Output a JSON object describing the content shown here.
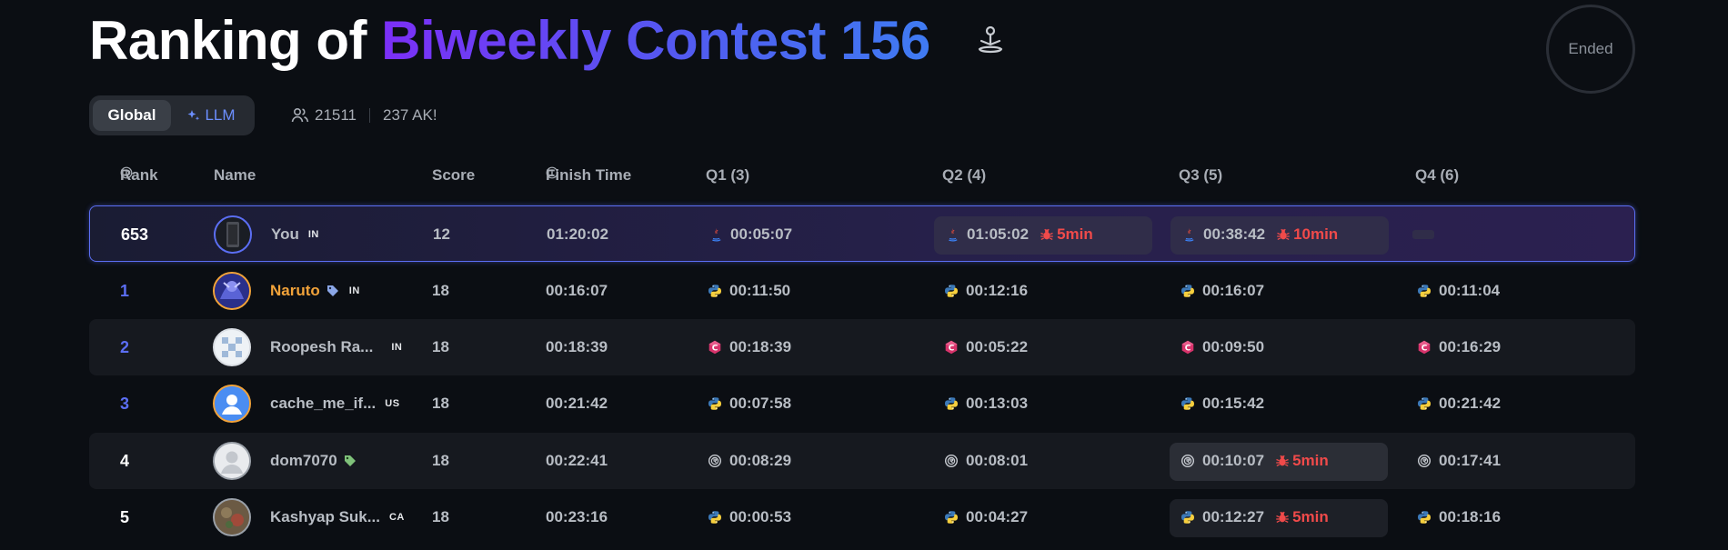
{
  "header": {
    "title_prefix": "Ranking of ",
    "title_highlight": "Biweekly Contest 156",
    "status": "Ended"
  },
  "toggle": {
    "global_label": "Global",
    "llm_label": "LLM"
  },
  "stats": {
    "participants": "21511",
    "ak": "237 AK!"
  },
  "columns": {
    "rank": "Rank",
    "name": "Name",
    "score": "Score",
    "finish": "Finish Time",
    "q1": "Q1 (3)",
    "q2": "Q2 (4)",
    "q3": "Q3 (5)",
    "q4": "Q4 (6)"
  },
  "rows": [
    {
      "rank": "653",
      "name": "You",
      "flag": "IN",
      "score": "12",
      "finish": "01:20:02",
      "q1": "00:05:07",
      "q2": "01:05:02",
      "q2_penalty": "5min",
      "q3": "00:38:42",
      "q3_penalty": "10min"
    },
    {
      "rank": "1",
      "name": "Naruto",
      "flag": "IN",
      "score": "18",
      "finish": "00:16:07",
      "q1": "00:11:50",
      "q2": "00:12:16",
      "q3": "00:16:07",
      "q4": "00:11:04"
    },
    {
      "rank": "2",
      "name": "Roopesh Ra...",
      "flag": "IN",
      "score": "18",
      "finish": "00:18:39",
      "q1": "00:18:39",
      "q2": "00:05:22",
      "q3": "00:09:50",
      "q4": "00:16:29"
    },
    {
      "rank": "3",
      "name": "cache_me_if...",
      "flag": "US",
      "score": "18",
      "finish": "00:21:42",
      "q1": "00:07:58",
      "q2": "00:13:03",
      "q3": "00:15:42",
      "q4": "00:21:42"
    },
    {
      "rank": "4",
      "name": "dom7070",
      "flag": "",
      "score": "18",
      "finish": "00:22:41",
      "q1": "00:08:29",
      "q2": "00:08:01",
      "q3": "00:10:07",
      "q3_penalty": "5min",
      "q4": "00:17:41"
    },
    {
      "rank": "5",
      "name": "Kashyap Suk...",
      "flag": "CA",
      "score": "18",
      "finish": "00:23:16",
      "q1": "00:00:53",
      "q2": "00:04:27",
      "q3": "00:12:27",
      "q3_penalty": "5min",
      "q4": "00:18:16"
    }
  ],
  "colors": {
    "accent": "#5b6ef3",
    "penalty": "#f04a4a",
    "gold": "#f2a33a"
  },
  "icons": {
    "java": "java-icon",
    "python": "python-icon",
    "cpp": "cpp-icon",
    "rust": "rust-icon",
    "bug": "bug-icon"
  }
}
